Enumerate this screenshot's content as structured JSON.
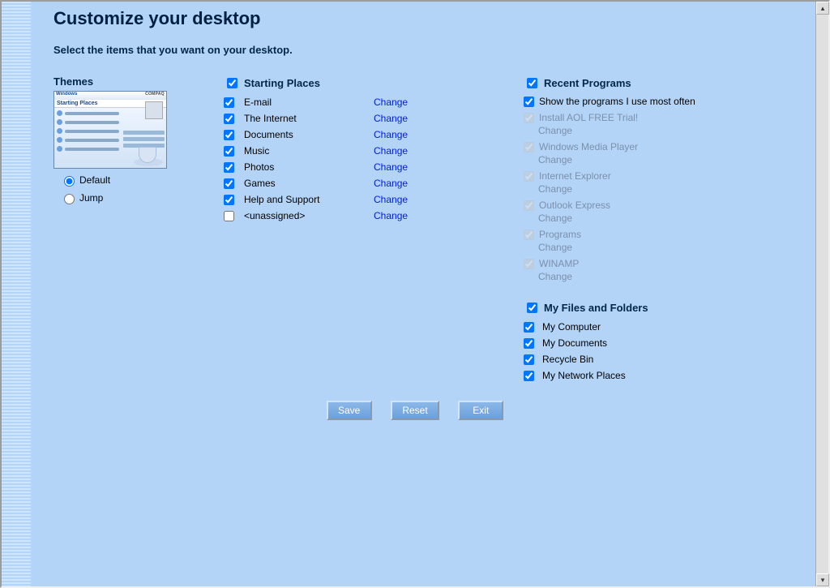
{
  "title": "Customize your desktop",
  "subtitle": "Select the items that you want on your desktop.",
  "themes": {
    "heading": "Themes",
    "thumb": {
      "brand_left": "Windows",
      "brand_right": "COMPAQ",
      "heading": "Starting Places"
    },
    "options": [
      {
        "label": "Default",
        "checked": true
      },
      {
        "label": "Jump",
        "checked": false
      }
    ]
  },
  "starting": {
    "heading": "Starting Places",
    "master_checked": true,
    "items": [
      {
        "label": "E-mail",
        "checked": true,
        "change": "Change"
      },
      {
        "label": "The Internet",
        "checked": true,
        "change": "Change"
      },
      {
        "label": "Documents",
        "checked": true,
        "change": "Change"
      },
      {
        "label": "Music",
        "checked": true,
        "change": "Change"
      },
      {
        "label": "Photos",
        "checked": true,
        "change": "Change"
      },
      {
        "label": "Games",
        "checked": true,
        "change": "Change"
      },
      {
        "label": "Help and Support",
        "checked": true,
        "change": "Change"
      },
      {
        "label": "<unassigned>",
        "checked": false,
        "change": "Change"
      }
    ]
  },
  "recent": {
    "heading": "Recent Programs",
    "master_checked": true,
    "show_row": {
      "label": "Show the programs I use most often",
      "checked": true
    },
    "items": [
      {
        "label": "Install AOL FREE Trial!",
        "checked": true,
        "disabled": true,
        "change": "Change"
      },
      {
        "label": "Windows Media Player",
        "checked": true,
        "disabled": true,
        "change": "Change"
      },
      {
        "label": "Internet Explorer",
        "checked": true,
        "disabled": true,
        "change": "Change"
      },
      {
        "label": "Outlook Express",
        "checked": true,
        "disabled": true,
        "change": "Change"
      },
      {
        "label": "Programs",
        "checked": true,
        "disabled": true,
        "change": "Change"
      },
      {
        "label": "WINAMP",
        "checked": true,
        "disabled": true,
        "change": "Change"
      }
    ]
  },
  "files": {
    "heading": "My Files and Folders",
    "master_checked": true,
    "items": [
      {
        "label": "My Computer",
        "checked": true
      },
      {
        "label": "My Documents",
        "checked": true
      },
      {
        "label": "Recycle Bin",
        "checked": true
      },
      {
        "label": "My Network Places",
        "checked": true
      }
    ]
  },
  "buttons": {
    "save": "Save",
    "reset": "Reset",
    "exit": "Exit"
  }
}
